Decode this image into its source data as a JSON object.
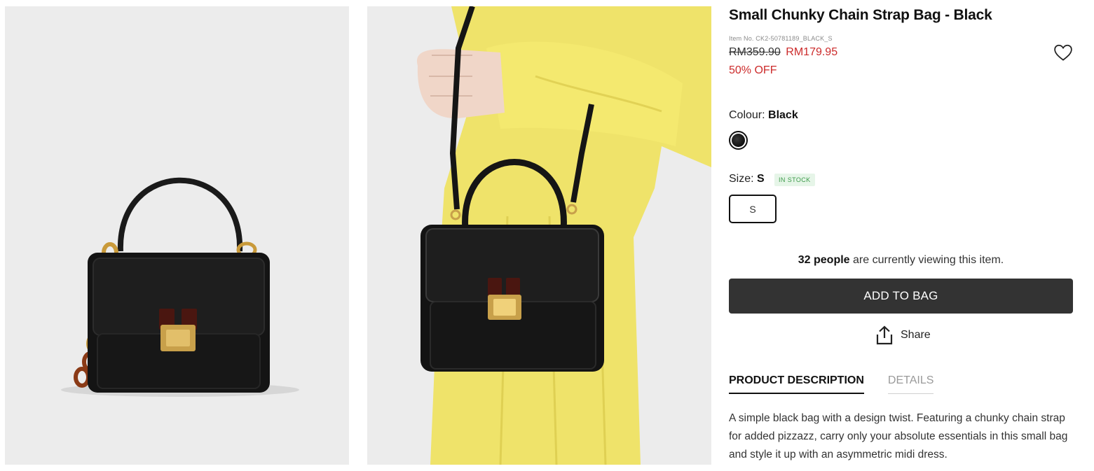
{
  "gallery": {
    "image_1_alt": "black-handbag-with-chain-strap",
    "image_2_alt": "model-holding-black-handbag"
  },
  "product": {
    "title": "Small Chunky Chain Strap Bag - Black",
    "item_no": "Item No. CK2-50781189_BLACK_S",
    "price_old": "RM359.90",
    "price_new": "RM179.95",
    "discount": "50% OFF",
    "wishlist_icon": "heart-outline-icon"
  },
  "colour": {
    "label": "Colour:",
    "value": "Black",
    "swatch_color": "#111111"
  },
  "size": {
    "label": "Size:",
    "value": "S",
    "stock_badge": "IN STOCK",
    "options": [
      "S"
    ]
  },
  "viewing": {
    "count_text": "32 people",
    "rest": " are currently viewing this item."
  },
  "actions": {
    "add_to_bag": "ADD TO BAG",
    "share": "Share",
    "share_icon": "share-upload-icon"
  },
  "tabs": [
    {
      "label": "PRODUCT DESCRIPTION",
      "active": true
    },
    {
      "label": "DETAILS",
      "active": false
    }
  ],
  "description": "A simple black bag with a design twist. Featuring a chunky chain strap for added pizzazz, carry only your absolute essentials in this small bag and style it up with an asymmetric midi dress.",
  "colors": {
    "sale_red": "#cc2b2b",
    "button_dark": "#333333",
    "stock_green": "#3d9a4a"
  }
}
